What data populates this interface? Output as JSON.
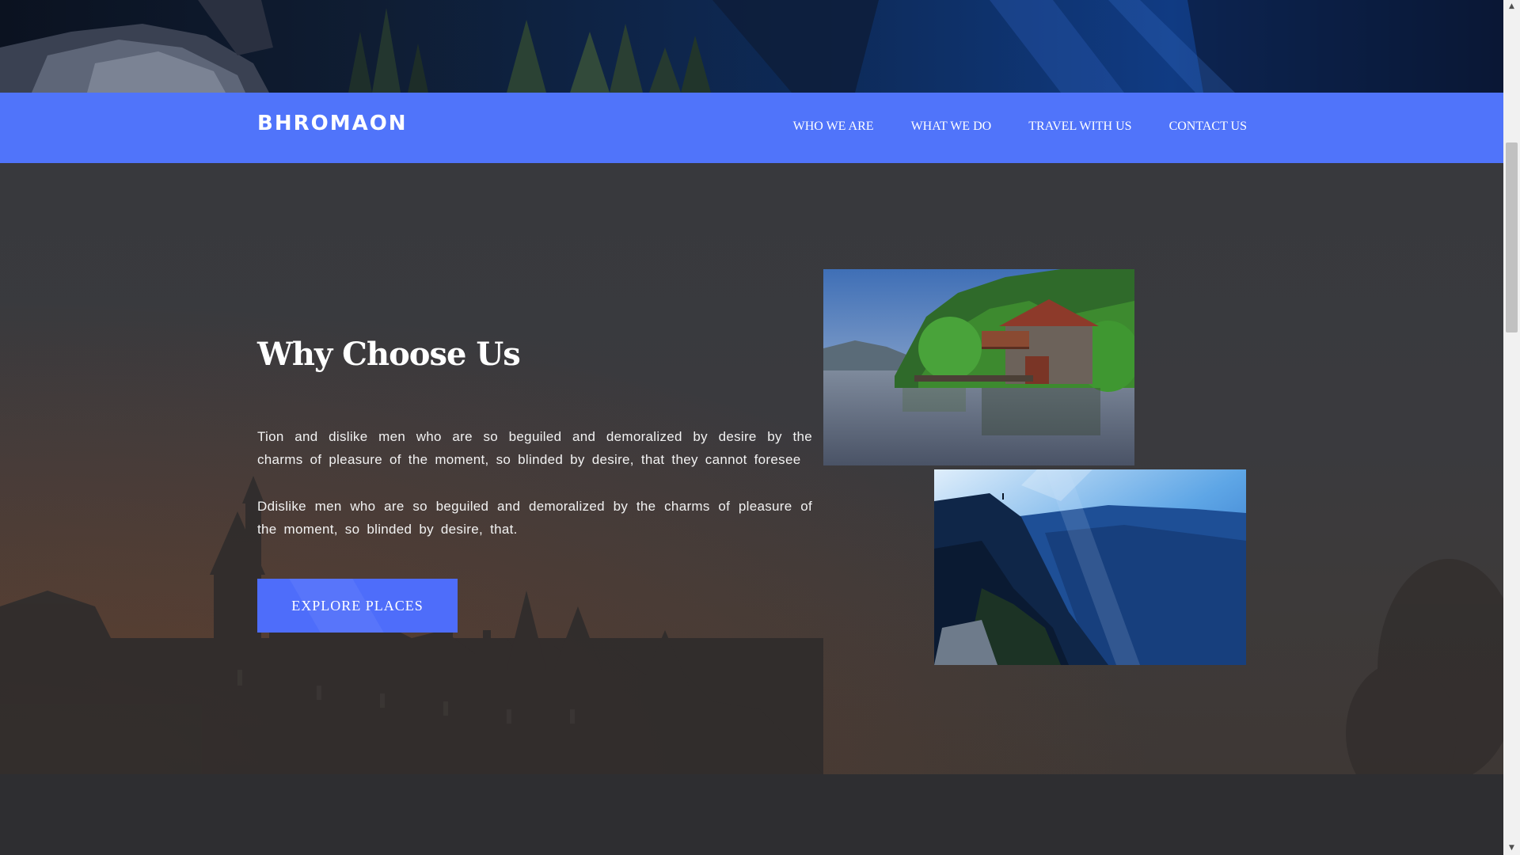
{
  "navbar": {
    "brand": "BHROMAON",
    "links": [
      {
        "label": "WHO WE ARE"
      },
      {
        "label": "WHAT WE DO"
      },
      {
        "label": "TRAVEL WITH US"
      },
      {
        "label": "CONTACT US"
      }
    ],
    "background_color": "#5074fa"
  },
  "section": {
    "heading": "Why Choose Us",
    "paragraphs": [
      "Tion and dislike men who are so beguiled and demoralized by desire by the charms of pleasure of the moment, so blinded by desire, that they cannot foresee",
      "Ddislike men who are so beguiled and demoralized by the charms of pleasure of the moment, so blinded by desire, that."
    ],
    "cta_label": "EXPLORE PLACES",
    "cta_color": "#4e6dfa",
    "images": [
      {
        "name": "lake-boathouse-photo"
      },
      {
        "name": "mountain-valley-photo"
      }
    ]
  },
  "scrollbar": {
    "up_icon": "triangle-up-icon",
    "down_icon": "triangle-down-icon"
  }
}
